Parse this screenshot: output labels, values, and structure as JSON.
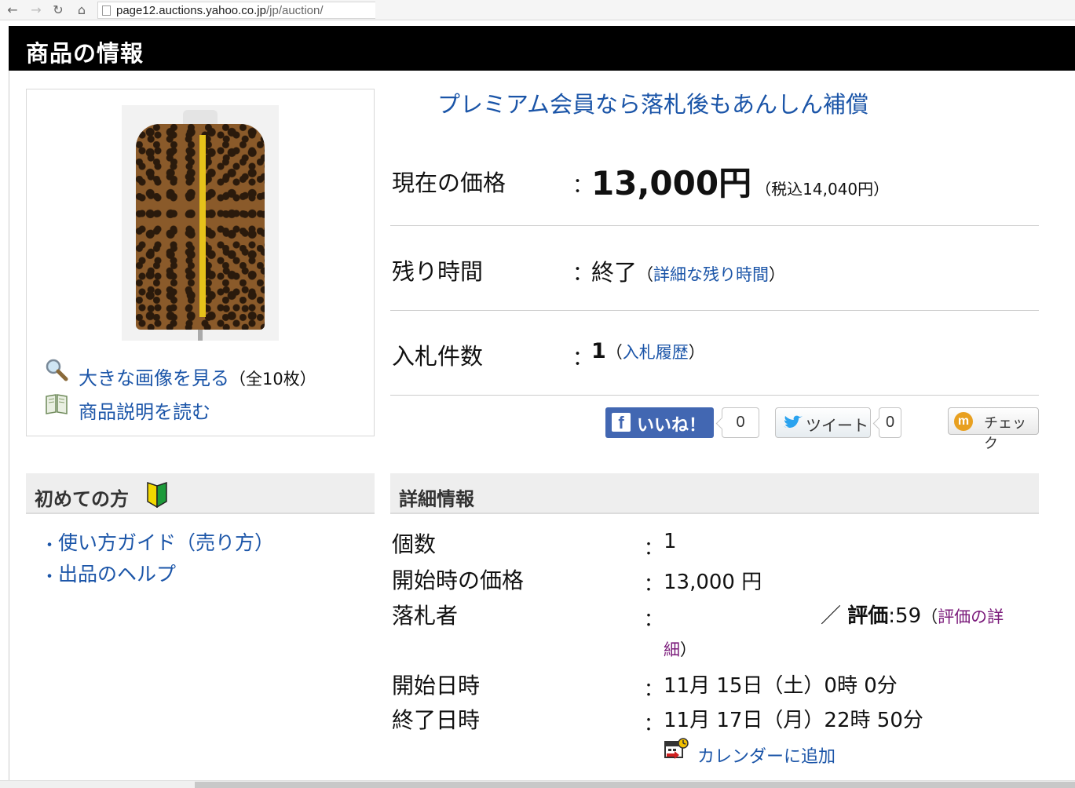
{
  "browser": {
    "url_host": "page12.auctions.yahoo.co.jp",
    "url_path": "/jp/auction/"
  },
  "header": {
    "title": "商品の情報"
  },
  "photo_links": [
    {
      "label": "大きな画像を見る",
      "note": "（全10枚）"
    },
    {
      "label": "商品説明を読む"
    }
  ],
  "beginner": {
    "title": "初めての方",
    "items": [
      {
        "label": "使い方ガイド（売り方）"
      },
      {
        "label": "出品のヘルプ"
      }
    ],
    "bullet": "・"
  },
  "premium_link": "プレミアム会員なら落札後もあんしん補償",
  "summary": {
    "colon": "：",
    "price": {
      "label": "現在の価格",
      "value": "13,000円",
      "tax": "（税込14,040円）"
    },
    "time": {
      "label": "残り時間",
      "value": "終了",
      "link_open": "（",
      "link": "詳細な残り時間",
      "link_close": "）"
    },
    "bids": {
      "label": "入札件数",
      "value": "1",
      "link_open": "（",
      "link": "入札履歴",
      "link_close": "）"
    }
  },
  "social": {
    "like_label": "いいね！",
    "like_count": "0",
    "tweet_label": "ツイート",
    "tweet_count": "0",
    "check_label": "チェック"
  },
  "details": {
    "title": "詳細情報",
    "colon": "：",
    "quantity": {
      "label": "個数",
      "value": "1"
    },
    "start_price": {
      "label": "開始時の価格",
      "value": "13,000 円"
    },
    "winner": {
      "label": "落札者",
      "slash": "／",
      "rating_label": "評価",
      "rating_value": ":59",
      "link_open": "（",
      "link_line1": "評価の詳",
      "link_line2": "細",
      "link_close": "）"
    },
    "start_date": {
      "label": "開始日時",
      "value": "11月 15日（土）0時 0分"
    },
    "end_date": {
      "label": "終了日時",
      "value": "11月 17日（月）22時 50分"
    },
    "calendar_link": "カレンダーに追加"
  },
  "colors": {
    "link": "#1b55a8",
    "visited_link": "#7a1a7a",
    "header_bg": "#000000",
    "facebook": "#4267b2"
  }
}
